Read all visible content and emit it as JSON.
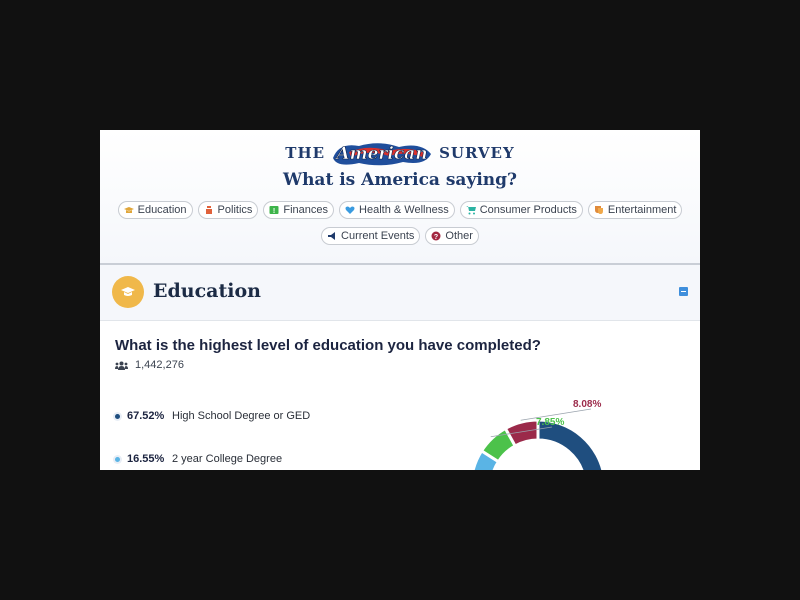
{
  "header": {
    "logo_left": "THE",
    "logo_script": "American",
    "logo_right": "SURVEY",
    "tagline": "What is America saying?",
    "categories": [
      {
        "label": "Education",
        "icon": "graduation-cap-icon",
        "color": "#e0a63a"
      },
      {
        "label": "Politics",
        "icon": "podium-icon",
        "color": "#e0613a"
      },
      {
        "label": "Finances",
        "icon": "money-icon",
        "color": "#3db44a"
      },
      {
        "label": "Health & Wellness",
        "icon": "heartbeat-icon",
        "color": "#3a9be0"
      },
      {
        "label": "Consumer Products",
        "icon": "cart-icon",
        "color": "#2bb3a3"
      },
      {
        "label": "Entertainment",
        "icon": "masks-icon",
        "color": "#e08a3a"
      },
      {
        "label": "Current Events",
        "icon": "megaphone-icon",
        "color": "#1f3a6b"
      },
      {
        "label": "Other",
        "icon": "question-icon",
        "color": "#a32640"
      }
    ]
  },
  "section": {
    "title": "Education",
    "icon": "graduation-cap-icon",
    "accent": "#f0b84a"
  },
  "question": {
    "text": "What is the highest level of education you have completed?",
    "respondents": "1,442,276",
    "answers": [
      {
        "pct": "67.52%",
        "label": "High School Degree or GED",
        "color": "#1f4e7f"
      },
      {
        "pct": "16.55%",
        "label": "2 year College Degree",
        "color": "#5ab4e5"
      }
    ]
  },
  "chart_data": {
    "type": "pie",
    "donut": true,
    "slices": [
      {
        "label": "High School Degree or GED",
        "value": 67.52,
        "color": "#1f4e7f"
      },
      {
        "label": "2 year College Degree",
        "value": 16.55,
        "color": "#5ab4e5"
      },
      {
        "label": "",
        "value": 7.85,
        "color": "#4cc24a"
      },
      {
        "label": "",
        "value": 8.08,
        "color": "#9b2a4a"
      }
    ],
    "data_labels": [
      {
        "text": "8.08%",
        "color": "#9b2a4a"
      },
      {
        "text": "7.85%",
        "color": "#4cc24a"
      }
    ]
  }
}
